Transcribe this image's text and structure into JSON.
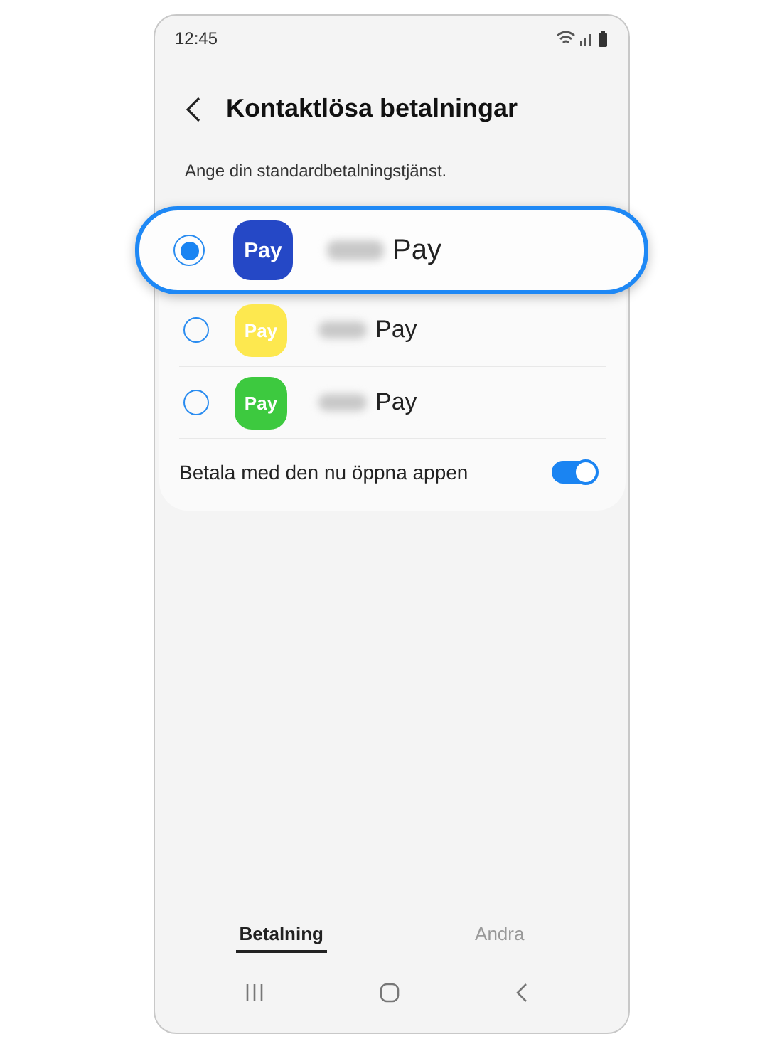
{
  "status_bar": {
    "time": "12:45"
  },
  "header": {
    "title": "Kontaktlösa betalningar"
  },
  "subtitle": "Ange din standardbetalningstjänst.",
  "payment_services": [
    {
      "icon_label": "Pay",
      "name": "Pay",
      "color": "#2548c6",
      "selected": true,
      "highlighted": true
    },
    {
      "icon_label": "Pay",
      "name": "Pay",
      "color": "#fde84f",
      "selected": false,
      "highlighted": false
    },
    {
      "icon_label": "Pay",
      "name": "Pay",
      "color": "#3dc93f",
      "selected": false,
      "highlighted": false
    }
  ],
  "open_app_setting": {
    "label": "Betala med den nu öppna appen",
    "on": true
  },
  "tabs": [
    {
      "label": "Betalning",
      "selected": true
    },
    {
      "label": "Andra",
      "selected": false
    }
  ]
}
